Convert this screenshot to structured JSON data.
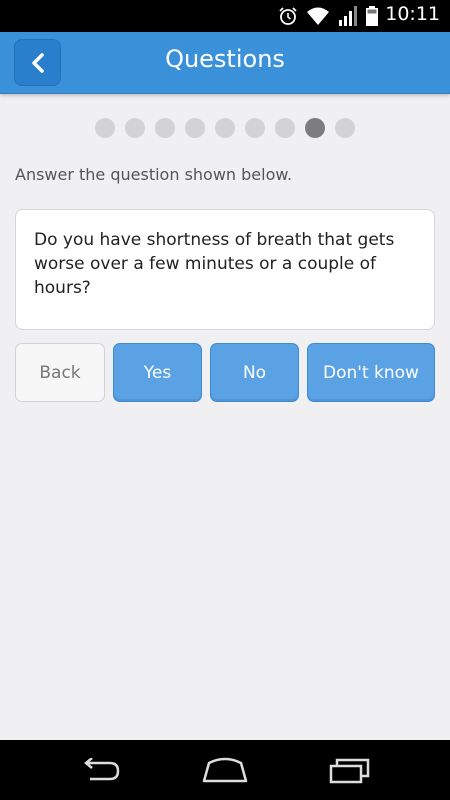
{
  "status_bar": {
    "time": "10:11",
    "icons": [
      "alarm-icon",
      "wifi-icon",
      "signal-icon",
      "battery-icon"
    ]
  },
  "header": {
    "title": "Questions",
    "back_icon": "chevron-left-icon"
  },
  "progress": {
    "total": 9,
    "current": 8
  },
  "instruction": "Answer the question shown below.",
  "question": "Do you have shortness of breath that gets worse over a few minutes or a couple of hours?",
  "answers": {
    "back_label": "Back",
    "yes_label": "Yes",
    "no_label": "No",
    "dont_know_label": "Don't know"
  },
  "colors": {
    "app_bar": "#3b91d9",
    "primary_button": "#5aa2e4",
    "dot_inactive": "#d3d3d5",
    "dot_active": "#7d7d7f"
  },
  "nav_bar": {
    "icons": [
      "back-nav-icon",
      "home-nav-icon",
      "recents-nav-icon"
    ]
  }
}
